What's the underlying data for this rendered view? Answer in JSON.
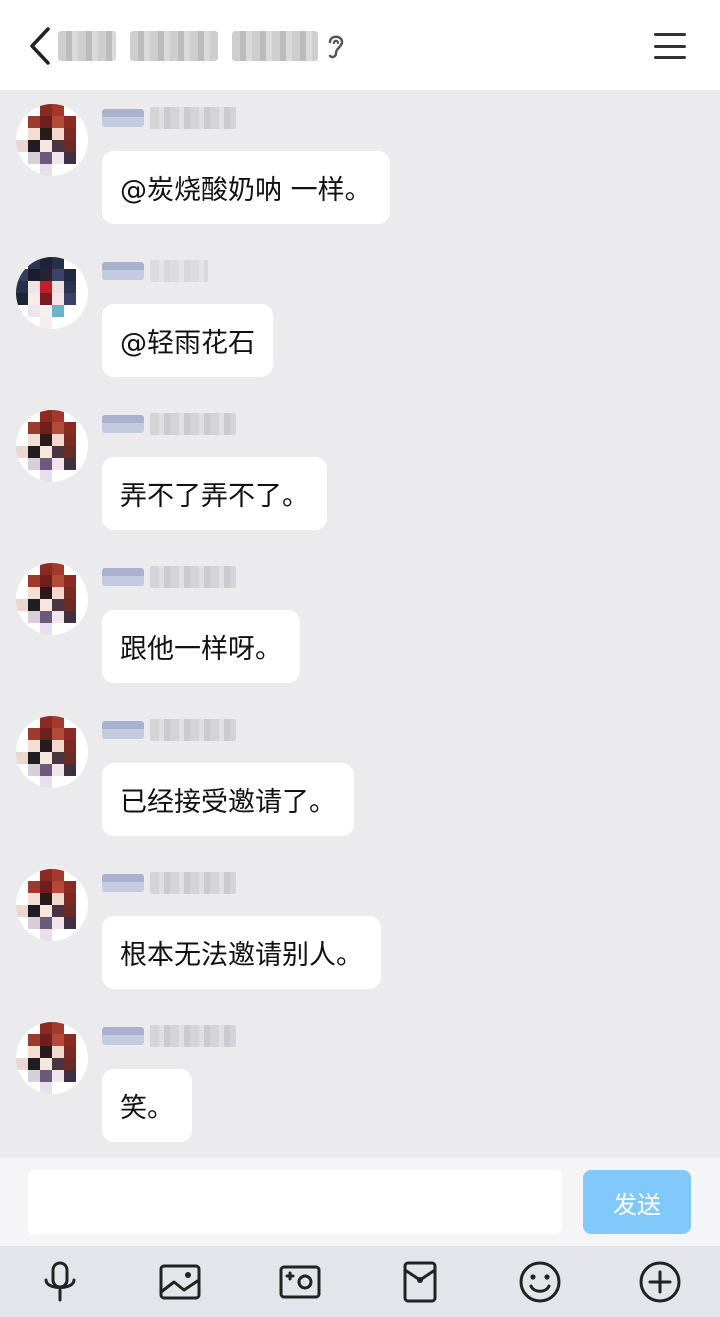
{
  "header": {
    "back_icon": "chevron-left-icon",
    "ear_icon": "ear-icon",
    "menu_icon": "menu-icon"
  },
  "messages": [
    {
      "text": "@炭烧酸奶呐 一样。",
      "avatar": "avatar-red-hair"
    },
    {
      "text": "@轻雨花石",
      "avatar": "avatar-dark-hair"
    },
    {
      "text": "弄不了弄不了。",
      "avatar": "avatar-red-hair"
    },
    {
      "text": "跟他一样呀。",
      "avatar": "avatar-red-hair"
    },
    {
      "text": "已经接受邀请了。",
      "avatar": "avatar-red-hair"
    },
    {
      "text": "根本无法邀请别人。",
      "avatar": "avatar-red-hair"
    },
    {
      "text": "笑。",
      "avatar": "avatar-red-hair"
    }
  ],
  "input": {
    "value": "",
    "send_label": "发送"
  },
  "toolbar": {
    "items": [
      "microphone-icon",
      "image-icon",
      "camera-icon",
      "red-packet-icon",
      "emoji-icon",
      "plus-icon"
    ]
  },
  "colors": {
    "background": "#ebebed",
    "send_button": "#81c8fb",
    "bubble": "#ffffff"
  }
}
